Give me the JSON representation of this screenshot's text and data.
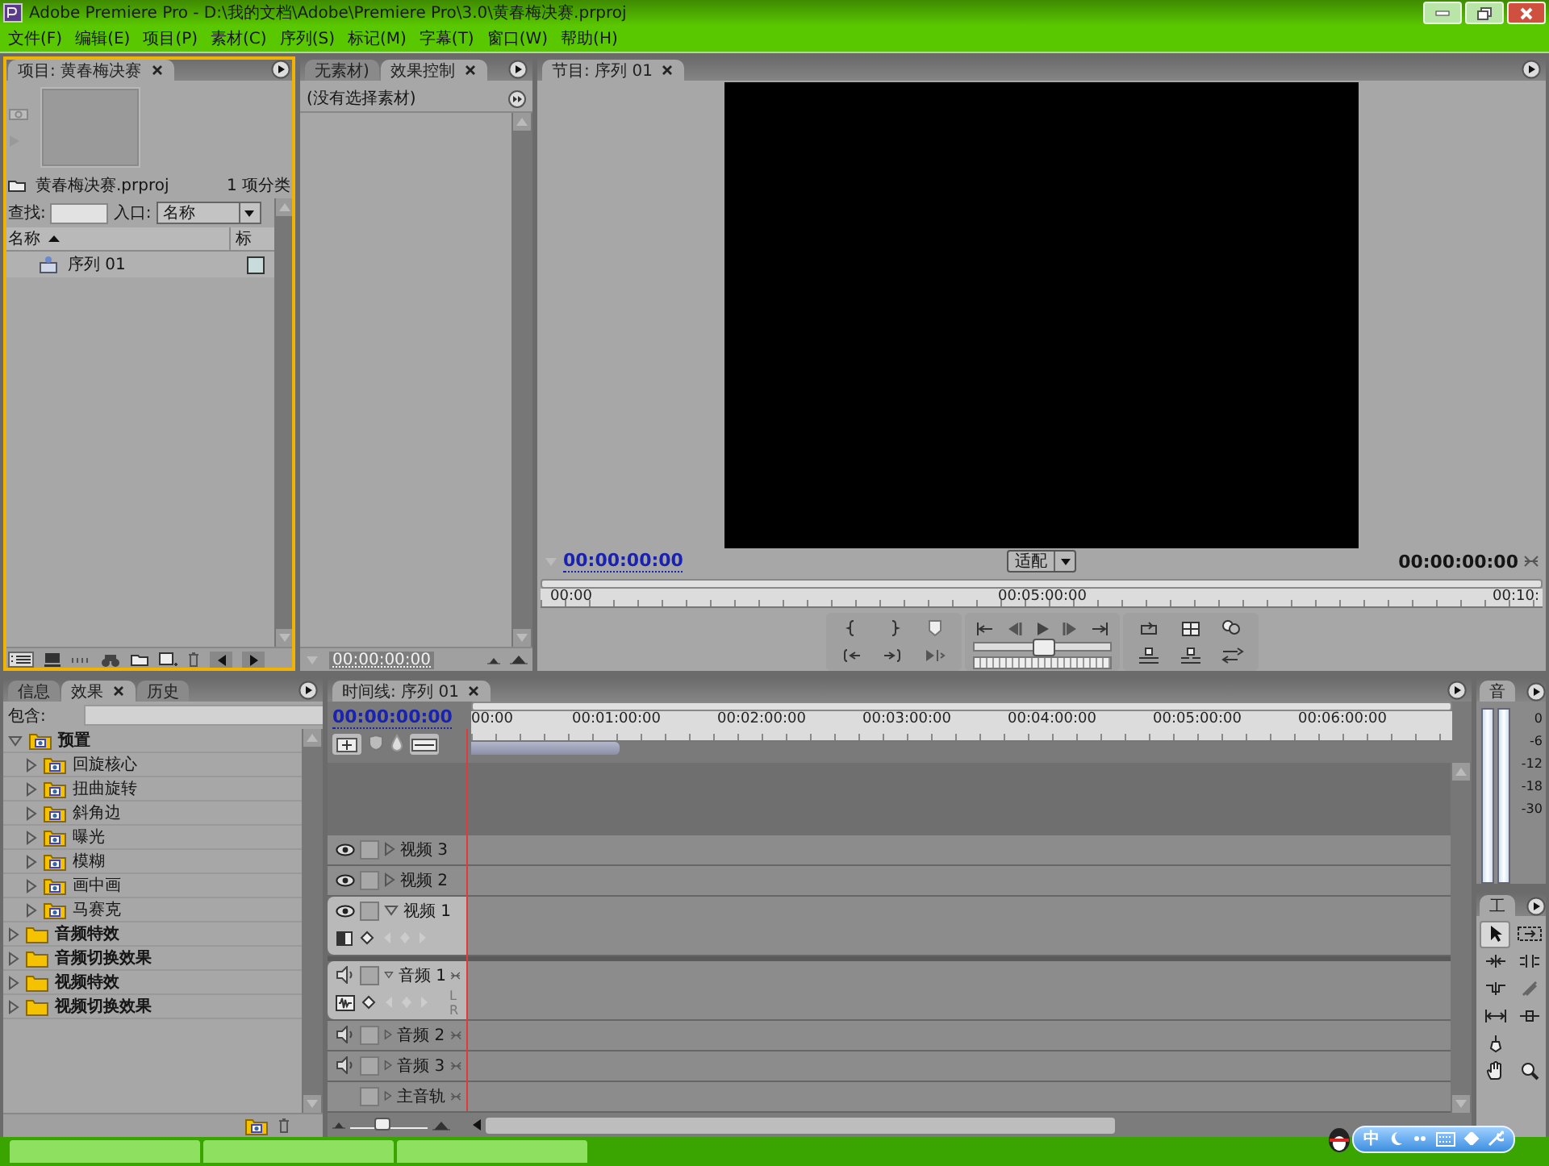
{
  "window": {
    "title": "Adobe Premiere Pro - D:\\我的文档\\Adobe\\Premiere Pro\\3.0\\黄春梅决赛.prproj"
  },
  "menu": [
    "文件(F)",
    "编辑(E)",
    "项目(P)",
    "素材(C)",
    "序列(S)",
    "标记(M)",
    "字幕(T)",
    "窗口(W)",
    "帮助(H)"
  ],
  "project_panel": {
    "focused": true,
    "tab": "项目: 黄春梅决赛",
    "file": "黄春梅决赛.prproj",
    "count": "1 项分类",
    "find_label": "查找:",
    "entry_label": "入口:",
    "entry_value": "名称",
    "columns": [
      "名称",
      "标"
    ],
    "items": [
      {
        "name": "序列 01",
        "color": "#c8dcdc"
      }
    ]
  },
  "source_panel": {
    "tabs": [
      {
        "label": "无素材)",
        "selected": false
      },
      {
        "label": "效果控制",
        "selected": true
      }
    ],
    "message": "(没有选择素材)",
    "timecode": "00:00:00:00"
  },
  "program_monitor": {
    "tab": "节目: 序列 01",
    "timecode_left": "00:00:00:00",
    "fit": "适配",
    "timecode_right": "00:00:00:00",
    "ruler": [
      "00:00",
      "00:05:00:00",
      "00:10:"
    ],
    "jog": {
      "level": 0.5
    }
  },
  "effects_panel": {
    "tabs": [
      {
        "label": "信息",
        "selected": false
      },
      {
        "label": "效果",
        "selected": true
      },
      {
        "label": "历史",
        "selected": false
      }
    ],
    "contains_label": "包含:",
    "tree": [
      {
        "label": "预置",
        "kind": "preset",
        "expanded": true,
        "children": [
          {
            "label": "回旋核心",
            "kind": "preset"
          },
          {
            "label": "扭曲旋转",
            "kind": "preset"
          },
          {
            "label": "斜角边",
            "kind": "preset"
          },
          {
            "label": "曝光",
            "kind": "preset"
          },
          {
            "label": "模糊",
            "kind": "preset"
          },
          {
            "label": "画中画",
            "kind": "preset"
          },
          {
            "label": "马赛克",
            "kind": "preset"
          }
        ]
      },
      {
        "label": "音频特效",
        "kind": "folder",
        "expanded": false
      },
      {
        "label": "音频切换效果",
        "kind": "folder",
        "expanded": false
      },
      {
        "label": "视频特效",
        "kind": "folder",
        "expanded": false
      },
      {
        "label": "视频切换效果",
        "kind": "folder",
        "expanded": false
      }
    ]
  },
  "timeline": {
    "tab": "时间线: 序列 01",
    "timecode": "00:00:00:00",
    "zoom": {
      "level": 0.4
    },
    "ruler": [
      "00:00",
      "00:01:00:00",
      "00:02:00:00",
      "00:03:00:00",
      "00:04:00:00",
      "00:05:00:00",
      "00:06:00:00"
    ],
    "tracks": [
      {
        "kind": "video",
        "name": "视频 3",
        "expanded": false
      },
      {
        "kind": "video",
        "name": "视频 2",
        "expanded": false
      },
      {
        "kind": "video",
        "name": "视频 1",
        "expanded": true
      },
      {
        "kind": "audio",
        "name": "音频 1",
        "expanded": true,
        "channels": [
          "L",
          "R"
        ]
      },
      {
        "kind": "audio",
        "name": "音频 2",
        "expanded": false
      },
      {
        "kind": "audio",
        "name": "音频 3",
        "expanded": false
      },
      {
        "kind": "master",
        "name": "主音轨",
        "expanded": false
      }
    ]
  },
  "audio_meter": {
    "tab": "音",
    "scale": [
      "0",
      "-6",
      "-12",
      "-18",
      "-30"
    ]
  },
  "tools": {
    "tab": "工"
  },
  "ime_bar": {
    "mode": "中"
  }
}
